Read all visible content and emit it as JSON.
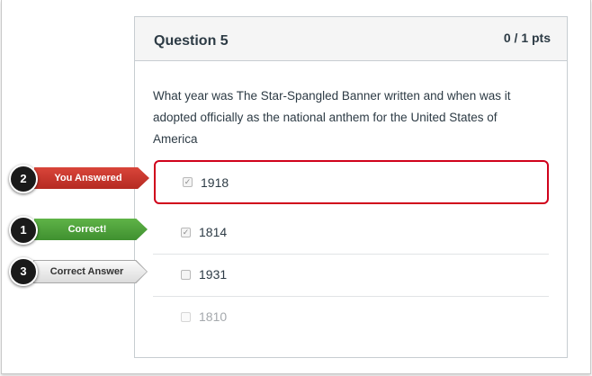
{
  "question": {
    "title": "Question 5",
    "points": "0 / 1 pts",
    "text": "What year was The Star-Spangled Banner written and when was it adopted officially as the national anthem for the United States of America"
  },
  "answers": [
    {
      "label": "1918",
      "checked": true,
      "state": "you-answered-wrong"
    },
    {
      "label": "1814",
      "checked": true,
      "state": "correct"
    },
    {
      "label": "1931",
      "checked": false,
      "state": "correct-answer"
    },
    {
      "label": "1810",
      "checked": false,
      "state": "disabled"
    }
  ],
  "callouts": [
    {
      "number": "2",
      "label": "You Answered",
      "color": "#c0392b"
    },
    {
      "number": "1",
      "label": "Correct!",
      "color": "#4a9e36"
    },
    {
      "number": "3",
      "label": "Correct Answer",
      "color": "#e6e6e6"
    }
  ]
}
